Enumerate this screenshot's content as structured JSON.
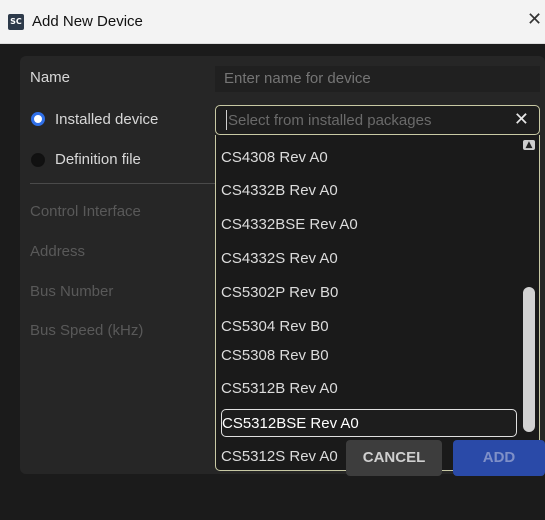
{
  "window": {
    "icon_text": "SC",
    "title": "Add New Device",
    "close_glyph": "✕"
  },
  "form": {
    "name_label": "Name",
    "name_placeholder": "Enter name for device",
    "installed_label": "Installed device",
    "definition_label": "Definition file",
    "control_interface_label": "Control Interface",
    "address_label": "Address",
    "bus_number_label": "Bus Number",
    "bus_speed_label": "Bus Speed (kHz)",
    "select_placeholder": "Select from installed packages",
    "clear_glyph": "✕"
  },
  "dropdown": {
    "options": [
      "CS4308 Rev A0",
      "CS4332B Rev A0",
      "CS4332BSE Rev A0",
      "CS4332S Rev A0",
      "CS5302P Rev B0",
      "CS5304 Rev B0",
      "CS5308 Rev B0",
      "CS5312B Rev A0",
      "CS5312BSE Rev A0",
      "CS5312S Rev A0"
    ],
    "highlighted": "CS5312BSE Rev A0"
  },
  "buttons": {
    "cancel": "CANCEL",
    "add": "ADD"
  },
  "colors": {
    "accent": "#2f6fe8",
    "dialog_bg": "#1b1b1b",
    "panel_bg": "#262626",
    "focus_border": "#c8c9a4"
  }
}
